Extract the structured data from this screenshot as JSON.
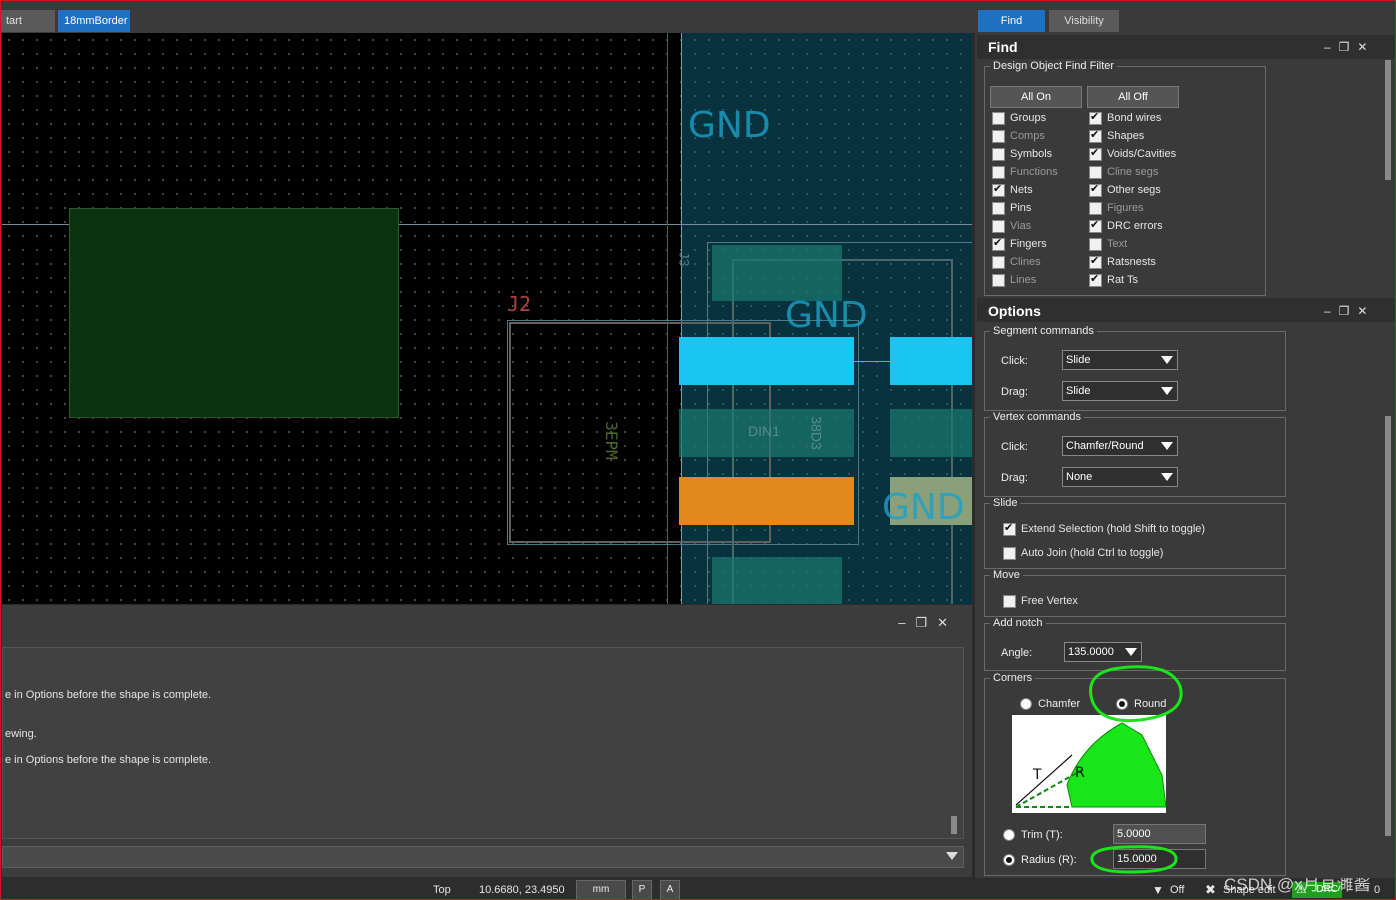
{
  "tabs": [
    {
      "label": "tart Page",
      "active": false
    },
    {
      "label": "18mmBorder",
      "active": true
    }
  ],
  "canvas": {
    "gnd_labels": [
      "GND",
      "GND",
      "GND"
    ],
    "refdes_j2": "J2",
    "refdes_j3": "J3",
    "label_din1": "DIN1",
    "label_3epm": "3EPM",
    "label_38d3": "38D3"
  },
  "console": {
    "lines": [
      "e in Options before the shape is complete.",
      "ewing.",
      "e in Options before the shape is complete."
    ],
    "command_input": ""
  },
  "status": {
    "layer": "Top",
    "coords": "10.6680, 23.4950",
    "units": "mm",
    "p_btn": "P",
    "a_btn": "A",
    "filter": "Off",
    "mode": "Shape edit",
    "drc": "DRC",
    "drc_count": "0",
    "watermark": "CSDN @x月亘濉酱"
  },
  "right": {
    "tabs": [
      "Find",
      "Visibility"
    ],
    "find": {
      "title": "Find",
      "group_title": "Design Object Find Filter",
      "all_on": "All On",
      "all_off": "All Off",
      "left_items": [
        {
          "label": "Groups",
          "checked": false,
          "dim": false
        },
        {
          "label": "Comps",
          "checked": false,
          "dim": true
        },
        {
          "label": "Symbols",
          "checked": false,
          "dim": false
        },
        {
          "label": "Functions",
          "checked": false,
          "dim": true
        },
        {
          "label": "Nets",
          "checked": true,
          "dim": false
        },
        {
          "label": "Pins",
          "checked": false,
          "dim": false
        },
        {
          "label": "Vias",
          "checked": false,
          "dim": true
        },
        {
          "label": "Fingers",
          "checked": true,
          "dim": false
        },
        {
          "label": "Clines",
          "checked": false,
          "dim": true
        },
        {
          "label": "Lines",
          "checked": false,
          "dim": true
        }
      ],
      "right_items": [
        {
          "label": "Bond wires",
          "checked": true,
          "dim": false
        },
        {
          "label": "Shapes",
          "checked": true,
          "dim": false
        },
        {
          "label": "Voids/Cavities",
          "checked": true,
          "dim": false
        },
        {
          "label": "Cline segs",
          "checked": false,
          "dim": true
        },
        {
          "label": "Other segs",
          "checked": true,
          "dim": false
        },
        {
          "label": "Figures",
          "checked": false,
          "dim": true
        },
        {
          "label": "DRC errors",
          "checked": true,
          "dim": false
        },
        {
          "label": "Text",
          "checked": false,
          "dim": true
        },
        {
          "label": "Ratsnests",
          "checked": true,
          "dim": false
        },
        {
          "label": "Rat Ts",
          "checked": true,
          "dim": false
        }
      ]
    },
    "options": {
      "title": "Options",
      "segment": {
        "title": "Segment commands",
        "click_label": "Click:",
        "click": "Slide",
        "drag_label": "Drag:",
        "drag": "Slide"
      },
      "vertex": {
        "title": "Vertex commands",
        "click_label": "Click:",
        "click": "Chamfer/Round",
        "drag_label": "Drag:",
        "drag": "None"
      },
      "slide": {
        "title": "Slide",
        "extend": "Extend Selection (hold Shift to toggle)",
        "extend_checked": true,
        "autojoin": "Auto Join (hold Ctrl to toggle)",
        "autojoin_checked": false
      },
      "move": {
        "title": "Move",
        "free_vertex": "Free Vertex",
        "free_vertex_checked": false
      },
      "notch": {
        "title": "Add notch",
        "angle_label": "Angle:",
        "angle": "135.0000"
      },
      "corners": {
        "title": "Corners",
        "chamfer": "Chamfer",
        "round": "Round",
        "selected": "Round",
        "diagram_t": "T",
        "diagram_r": "R",
        "trim_label": "Trim (T):",
        "trim": "5.0000",
        "radius_label": "Radius (R):",
        "radius": "15.0000",
        "selected_param": "Radius"
      }
    }
  }
}
